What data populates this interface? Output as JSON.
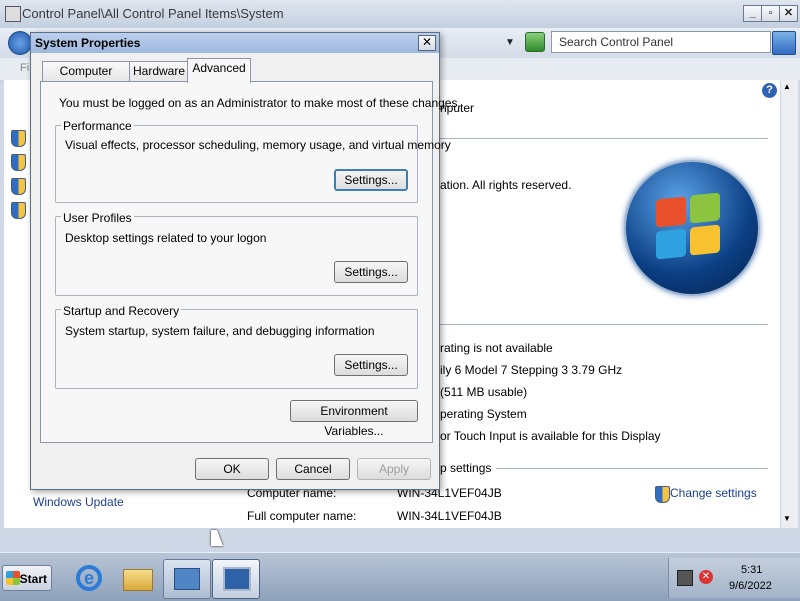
{
  "window": {
    "title": "Control Panel\\All Control Panel Items\\System",
    "search_placeholder": "Search Control Panel",
    "toolbar_first_letter": "Fi"
  },
  "background_content": {
    "rows": [
      {
        "text": "nputer"
      },
      {
        "text": "ation.  All rights reserved."
      },
      {
        "text": "rating is not available"
      },
      {
        "text": "ily 6 Model 7 Stepping 3   3.79 GHz"
      },
      {
        "text": "(511 MB usable)"
      },
      {
        "text": "perating System"
      },
      {
        "text": "or Touch Input is available for this Display"
      }
    ],
    "section_heading": "p settings",
    "computer_name_label": "Computer name:",
    "computer_name_value": "WIN-34L1VEF04JB",
    "full_name_label": "Full computer name:",
    "full_name_value": "WIN-34L1VEF04JB",
    "change_settings": "Change settings",
    "windows_update": "Windows Update"
  },
  "dialog": {
    "title": "System Properties",
    "close_label": "✕",
    "tabs": [
      "Computer Name",
      "Hardware",
      "Advanced"
    ],
    "active_tab": "Advanced",
    "admin_note": "You must be logged on as an Administrator to make most of these changes.",
    "groups": [
      {
        "label": "Performance",
        "desc": "Visual effects, processor scheduling, memory usage, and virtual memory",
        "button": "Settings..."
      },
      {
        "label": "User Profiles",
        "desc": "Desktop settings related to your logon",
        "button": "Settings..."
      },
      {
        "label": "Startup and Recovery",
        "desc": "System startup, system failure, and debugging information",
        "button": "Settings..."
      }
    ],
    "env_button": "Environment Variables...",
    "ok": "OK",
    "cancel": "Cancel",
    "apply": "Apply"
  },
  "taskbar": {
    "start": "Start",
    "time": "5:31",
    "date": "9/6/2022"
  }
}
